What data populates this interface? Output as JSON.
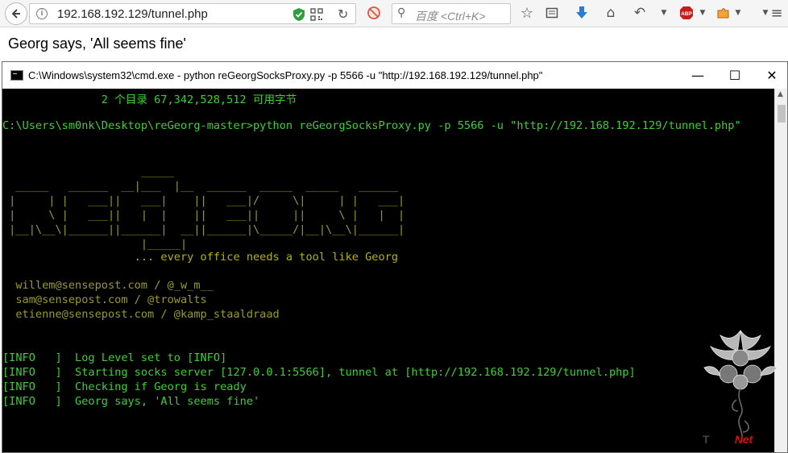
{
  "browser": {
    "url": "192.168.192.129/tunnel.php",
    "search_placeholder": "百度 <Ctrl+K>",
    "abp_label": "ABP",
    "icons": [
      "back-arrow-icon",
      "info-icon",
      "shield-icon",
      "qr-code-icon",
      "reload-icon",
      "block-icon",
      "search-icon",
      "star-icon",
      "reading-list-icon",
      "download-icon",
      "home-icon",
      "undo-icon",
      "adblock-icon",
      "puzzle-icon",
      "menu-icon"
    ]
  },
  "page": {
    "message": "Georg says, 'All seems fine'"
  },
  "cmd": {
    "title": "C:\\Windows\\system32\\cmd.exe - python  reGeorgSocksProxy.py -p 5566 -u \"http://192.168.192.129/tunnel.php\"",
    "dir_summary": "               2 个目录 67,342,528,512 可用字节",
    "command": "C:\\Users\\sm0nk\\Desktop\\reGeorg-master>python reGeorgSocksProxy.py -p 5566 -u \"http://192.168.192.129/tunnel.php\"",
    "logo_lines": [
      "                     _____",
      "  _____   ______  __|___  |__  ______  _____  _____   ______",
      " |     | |   ___||   ___|    ||   ___|/     \\|     | |   ___|",
      " |     \\ |   ___||   |  |    ||   ___||     ||     \\ |   |  |",
      " |__|\\__\\|______||______|  __||______|\\_____/|__|\\__\\|______|",
      "                     |_____|"
    ],
    "tagline": "                    ... every office needs a tool like Georg",
    "credits": [
      "  willem@sensepost.com / @_w_m__",
      "  sam@sensepost.com / @trowalts",
      "  etienne@sensepost.com / @kamp_staaldraad"
    ],
    "log": [
      "[INFO   ]  Log Level set to [INFO]",
      "[INFO   ]  Starting socks server [127.0.0.1:5566], tunnel at [http://192.168.192.129/tunnel.php]",
      "[INFO   ]  Checking if Georg is ready",
      "[INFO   ]  Georg says, 'All seems fine'"
    ]
  },
  "watermark": {
    "text_prefix": "T",
    "text_suffix": "Net"
  },
  "colors": {
    "console_green": "#3bd12f",
    "console_yellow": "#b4b300",
    "console_bg": "#000000"
  }
}
